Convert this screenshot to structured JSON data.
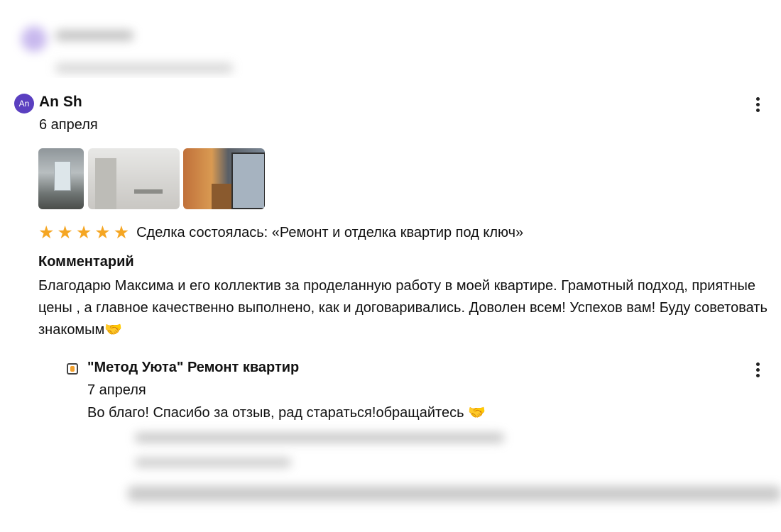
{
  "review": {
    "avatar_initials": "An",
    "author": "An Sh",
    "date": "6 апреля",
    "rating": 5,
    "stars": [
      "★",
      "★",
      "★",
      "★",
      "★"
    ],
    "deal": "Сделка состоялась: «Ремонт и отделка квартир под ключ»",
    "comment_label": "Комментарий",
    "comment_text": "Благодарю Максима и его коллектив за проделанную работу в моей квартире. Грамотный подход, приятные цены , а главное качественно выполнено, как и договаривались. Доволен всем! Успехов вам! Буду советовать знакомым🤝",
    "photo_count": 3
  },
  "reply": {
    "author": "\"Метод Уюта\" Ремонт квартир",
    "date": "7 апреля",
    "text": "Во благо! Спасибо за отзыв, рад стараться!обращайтесь 🤝"
  },
  "colors": {
    "star": "#f5a623",
    "avatar": "#5a3fc0",
    "text": "#111111"
  }
}
